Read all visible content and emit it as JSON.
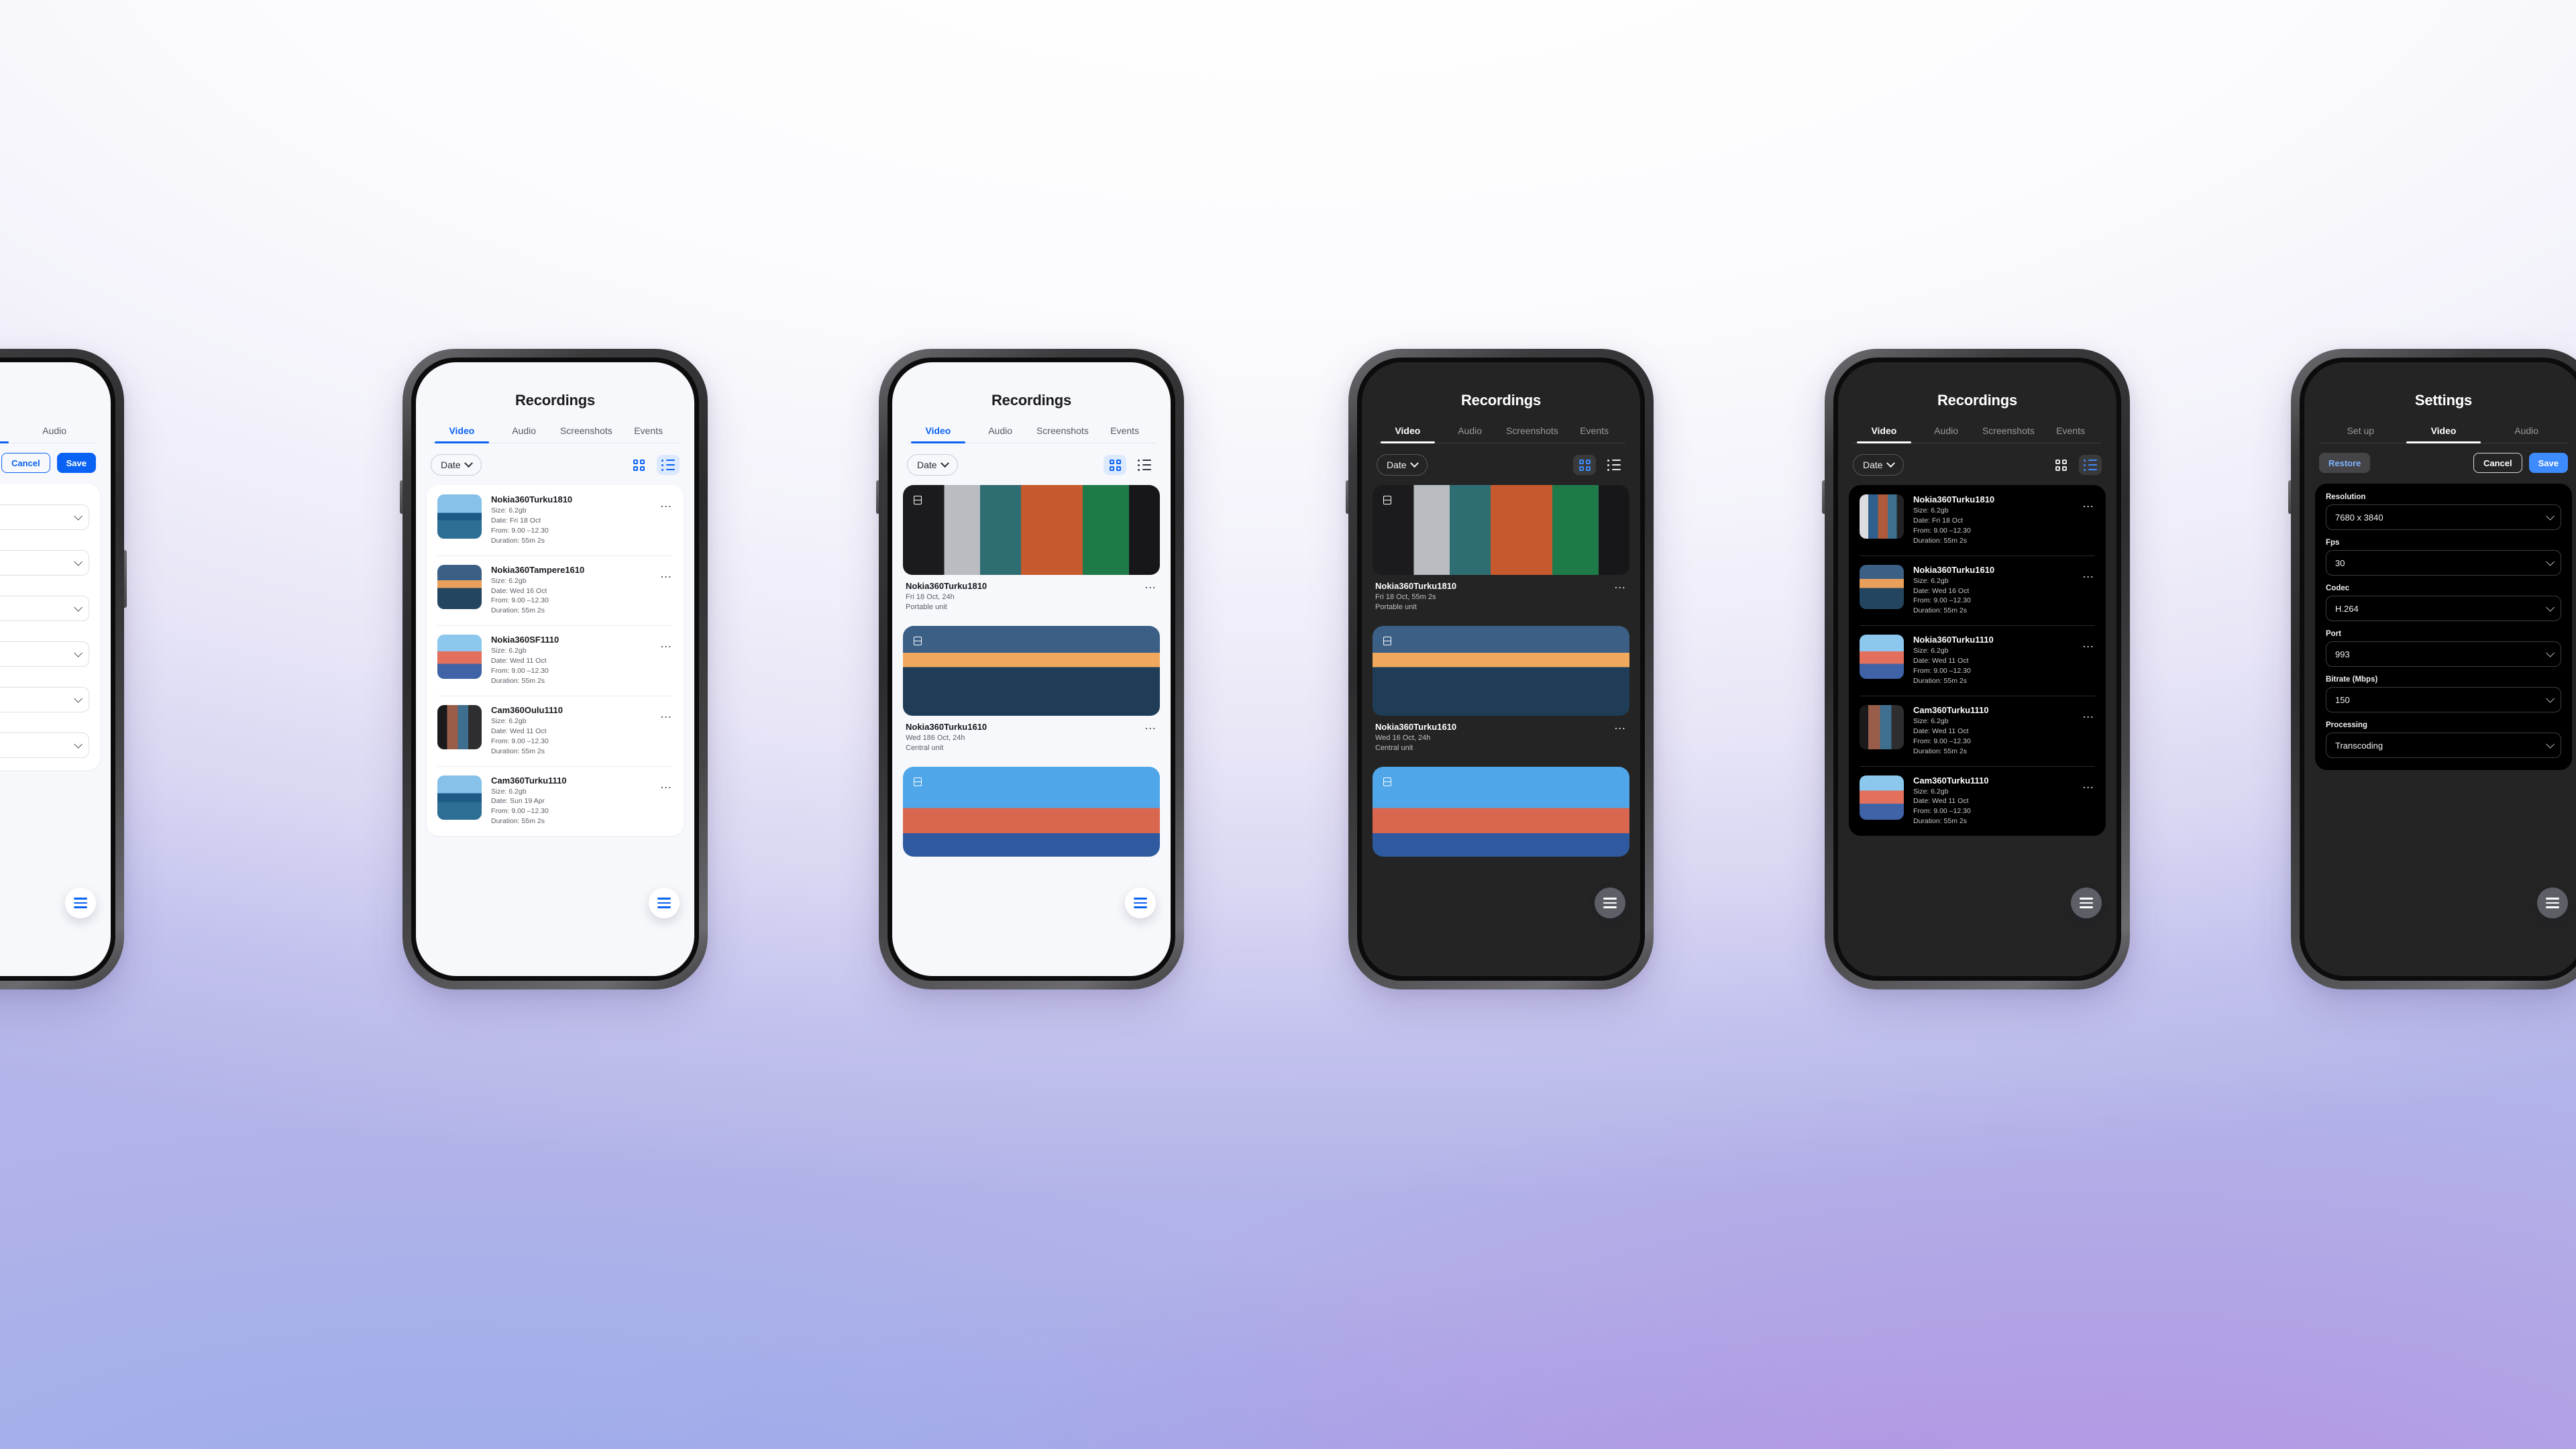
{
  "app": {
    "recordings_title": "Recordings",
    "settings_title": "Settings"
  },
  "recordings_tabs": [
    {
      "label": "Video",
      "active": true
    },
    {
      "label": "Audio",
      "active": false
    },
    {
      "label": "Screenshots",
      "active": false
    },
    {
      "label": "Events",
      "active": false
    }
  ],
  "settings_tabs": [
    {
      "label": "Set up",
      "active": false
    },
    {
      "label": "Video",
      "active": true
    },
    {
      "label": "Audio",
      "active": false
    }
  ],
  "toolbar": {
    "sort_label": "Date",
    "grid_icon": "grid-view-icon",
    "list_icon": "list-view-icon",
    "chevron_icon": "chevron-down-icon"
  },
  "fab": {
    "icon": "menu-lines-icon"
  },
  "row_overflow": "…",
  "settings_actions": {
    "restore_label": "Restore",
    "cancel_label": "Cancel",
    "save_label": "Save"
  },
  "settings_fields": [
    {
      "label": "Resolution",
      "value": "7680 x 3840"
    },
    {
      "label": "Fps",
      "value": "30"
    },
    {
      "label": "Codec",
      "value": "H.264"
    },
    {
      "label": "Port",
      "value": "993"
    },
    {
      "label": "Bitrate (Mbps)",
      "value": "150"
    },
    {
      "label": "Processing",
      "value": "Transcoding"
    }
  ],
  "list_items_light": [
    {
      "title": "Nokia360Turku1810",
      "size": "Size: 6.2gb",
      "date": "Date: Fri 18 Oct",
      "from": "From: 9.00 –12.30",
      "duration": "Duration: 55m 2s",
      "thumb": "ship-daylight"
    },
    {
      "title": "Nokia360Tampere1610",
      "size": "Size: 6.2gb",
      "date": "Date: Wed 16 Oct",
      "from": "From: 9.00 –12.30",
      "duration": "Duration: 55m 2s",
      "thumb": "cranes-sunset"
    },
    {
      "title": "Nokia360SF1110",
      "size": "Size: 6.2gb",
      "date": "Date: Wed 11 Oct",
      "from": "From: 9.00 –12.30",
      "duration": "Duration: 55m 2s",
      "thumb": "containers-stack"
    },
    {
      "title": "Cam360Oulu1110",
      "size": "Size: 6.2gb",
      "date": "Date: Wed 11 Oct",
      "from": "From: 9.00 –12.30",
      "duration": "Duration: 55m 2s",
      "thumb": "containers-night"
    },
    {
      "title": "Cam360Turku1110",
      "size": "Size: 6.2gb",
      "date": "Date: Sun 19 Apr",
      "from": "From: 9.00 –12.30",
      "duration": "Duration: 55m 2s",
      "thumb": "ship-daylight"
    }
  ],
  "list_items_dark": [
    {
      "title": "Nokia360Turku1810",
      "size": "Size: 6.2gb",
      "date": "Date: Fri 18 Oct",
      "from": "From: 9.00 –12.30",
      "duration": "Duration: 55m 2s",
      "thumb": "containers-night"
    },
    {
      "title": "Nokia360Turku1610",
      "size": "Size: 6.2gb",
      "date": "Date: Wed 16 Oct",
      "from": "From: 9.00 –12.30",
      "duration": "Duration: 55m 2s",
      "thumb": "cranes-sunset"
    },
    {
      "title": "Nokia360Turku1110",
      "size": "Size: 6.2gb",
      "date": "Date: Wed 11 Oct",
      "from": "From: 9.00 –12.30",
      "duration": "Duration: 55m 2s",
      "thumb": "containers-stack"
    },
    {
      "title": "Cam360Turku1110",
      "size": "Size: 6.2gb",
      "date": "Date: Wed 11 Oct",
      "from": "From: 9.00 –12.30",
      "duration": "Duration: 55m 2s",
      "thumb": "containers-night"
    },
    {
      "title": "Cam360Turku1110",
      "size": "Size: 6.2gb",
      "date": "Date: Wed 11 Oct",
      "from": "From: 9.00 –12.30",
      "duration": "Duration: 55m 2s",
      "thumb": "containers-stack"
    }
  ],
  "grid_items_light": [
    {
      "title": "Nokia360Turku1810",
      "sub": "Fri 18 Oct, 24h",
      "unit": "Portable unit",
      "thumb": "containers-night"
    },
    {
      "title": "Nokia360Turku1610",
      "sub": "Wed 186 Oct, 24h",
      "unit": "Central unit",
      "thumb": "cranes-sunset"
    },
    {
      "title": "",
      "sub": "",
      "unit": "",
      "thumb": "containers-stack"
    }
  ],
  "grid_items_dark": [
    {
      "title": "Nokia360Turku1810",
      "sub": "Fri 18 Oct, 55m 2s",
      "unit": "Portable unit",
      "thumb": "containers-night"
    },
    {
      "title": "Nokia360Turku1610",
      "sub": "Wed 16 Oct, 24h",
      "unit": "Central unit",
      "thumb": "cranes-sunset"
    },
    {
      "title": "",
      "sub": "",
      "unit": "",
      "thumb": "containers-stack"
    }
  ],
  "colors": {
    "accent_light": "#0a62f5",
    "accent_dark": "#3d8bfd",
    "screen_light_bg": "#f7f8fb",
    "screen_dark_bg": "#242424",
    "card_dark_bg": "#000000"
  }
}
